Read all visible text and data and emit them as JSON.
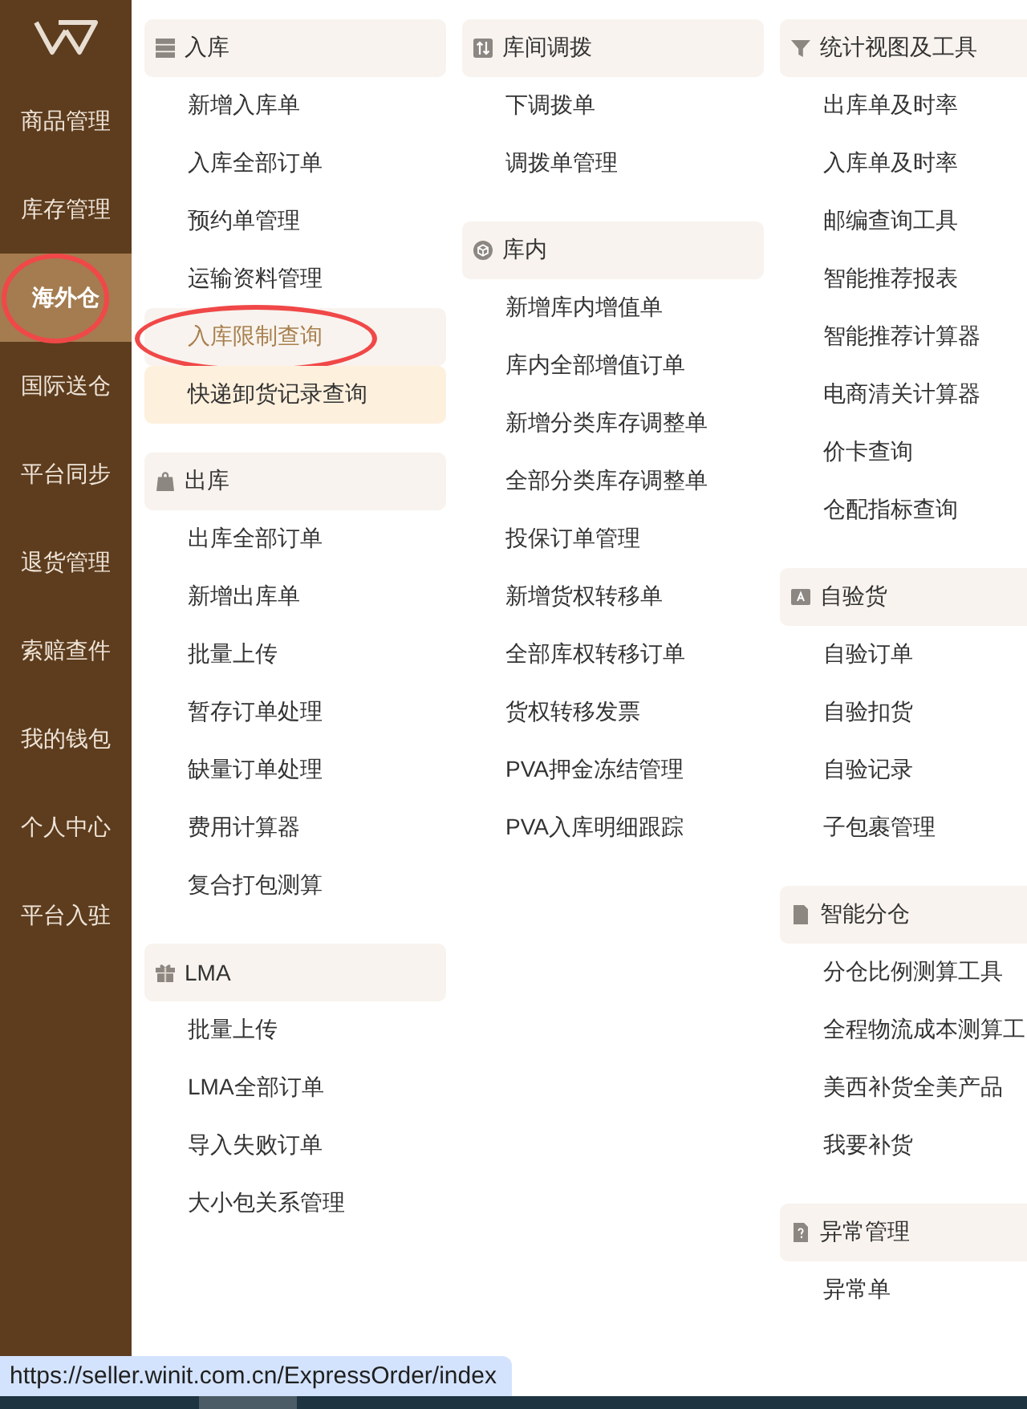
{
  "sidebar": {
    "items": [
      {
        "label": "商品管理",
        "selected": false,
        "circled": false
      },
      {
        "label": "库存管理",
        "selected": false,
        "circled": false
      },
      {
        "label": "海外仓",
        "selected": true,
        "circled": true
      },
      {
        "label": "国际送仓",
        "selected": false,
        "circled": false
      },
      {
        "label": "平台同步",
        "selected": false,
        "circled": false
      },
      {
        "label": "退货管理",
        "selected": false,
        "circled": false
      },
      {
        "label": "索赔查件",
        "selected": false,
        "circled": false
      },
      {
        "label": "我的钱包",
        "selected": false,
        "circled": false
      },
      {
        "label": "个人中心",
        "selected": false,
        "circled": false
      },
      {
        "label": "平台入驻",
        "selected": false,
        "circled": false
      }
    ]
  },
  "menu": {
    "columns": [
      {
        "groups": [
          {
            "title": "入库",
            "items": [
              {
                "label": "新增入库单",
                "selected": false,
                "hovered": false,
                "circled": false
              },
              {
                "label": "入库全部订单",
                "selected": false,
                "hovered": false,
                "circled": false
              },
              {
                "label": "预约单管理",
                "selected": false,
                "hovered": false,
                "circled": false
              },
              {
                "label": "运输资料管理",
                "selected": false,
                "hovered": false,
                "circled": false
              },
              {
                "label": "入库限制查询",
                "selected": false,
                "hovered": true,
                "circled": true
              },
              {
                "label": "快递卸货记录查询",
                "selected": true,
                "hovered": false,
                "circled": false
              }
            ]
          },
          {
            "title": "出库",
            "items": [
              {
                "label": "出库全部订单",
                "selected": false,
                "hovered": false,
                "circled": false
              },
              {
                "label": "新增出库单",
                "selected": false,
                "hovered": false,
                "circled": false
              },
              {
                "label": "批量上传",
                "selected": false,
                "hovered": false,
                "circled": false
              },
              {
                "label": "暂存订单处理",
                "selected": false,
                "hovered": false,
                "circled": false
              },
              {
                "label": "缺量订单处理",
                "selected": false,
                "hovered": false,
                "circled": false
              },
              {
                "label": "费用计算器",
                "selected": false,
                "hovered": false,
                "circled": false
              },
              {
                "label": "复合打包测算",
                "selected": false,
                "hovered": false,
                "circled": false
              }
            ]
          },
          {
            "title": "LMA",
            "items": [
              {
                "label": "批量上传",
                "selected": false,
                "hovered": false,
                "circled": false
              },
              {
                "label": "LMA全部订单",
                "selected": false,
                "hovered": false,
                "circled": false
              },
              {
                "label": "导入失败订单",
                "selected": false,
                "hovered": false,
                "circled": false
              },
              {
                "label": "大小包关系管理",
                "selected": false,
                "hovered": false,
                "circled": false
              }
            ]
          }
        ]
      },
      {
        "groups": [
          {
            "title": "库间调拨",
            "items": [
              {
                "label": "下调拨单",
                "selected": false,
                "hovered": false,
                "circled": false
              },
              {
                "label": "调拨单管理",
                "selected": false,
                "hovered": false,
                "circled": false
              }
            ]
          },
          {
            "title": "库内",
            "items": [
              {
                "label": "新增库内增值单",
                "selected": false,
                "hovered": false,
                "circled": false
              },
              {
                "label": "库内全部增值订单",
                "selected": false,
                "hovered": false,
                "circled": false
              },
              {
                "label": "新增分类库存调整单",
                "selected": false,
                "hovered": false,
                "circled": false
              },
              {
                "label": "全部分类库存调整单",
                "selected": false,
                "hovered": false,
                "circled": false
              },
              {
                "label": "投保订单管理",
                "selected": false,
                "hovered": false,
                "circled": false
              },
              {
                "label": "新增货权转移单",
                "selected": false,
                "hovered": false,
                "circled": false
              },
              {
                "label": "全部库权转移订单",
                "selected": false,
                "hovered": false,
                "circled": false
              },
              {
                "label": "货权转移发票",
                "selected": false,
                "hovered": false,
                "circled": false
              },
              {
                "label": "PVA押金冻结管理",
                "selected": false,
                "hovered": false,
                "circled": false
              },
              {
                "label": "PVA入库明细跟踪",
                "selected": false,
                "hovered": false,
                "circled": false
              }
            ]
          }
        ]
      },
      {
        "groups": [
          {
            "title": "统计视图及工具",
            "items": [
              {
                "label": "出库单及时率",
                "selected": false,
                "hovered": false,
                "circled": false
              },
              {
                "label": "入库单及时率",
                "selected": false,
                "hovered": false,
                "circled": false
              },
              {
                "label": "邮编查询工具",
                "selected": false,
                "hovered": false,
                "circled": false
              },
              {
                "label": "智能推荐报表",
                "selected": false,
                "hovered": false,
                "circled": false
              },
              {
                "label": "智能推荐计算器",
                "selected": false,
                "hovered": false,
                "circled": false
              },
              {
                "label": "电商清关计算器",
                "selected": false,
                "hovered": false,
                "circled": false
              },
              {
                "label": "价卡查询",
                "selected": false,
                "hovered": false,
                "circled": false
              },
              {
                "label": "仓配指标查询",
                "selected": false,
                "hovered": false,
                "circled": false
              }
            ]
          },
          {
            "title": "自验货",
            "items": [
              {
                "label": "自验订单",
                "selected": false,
                "hovered": false,
                "circled": false
              },
              {
                "label": "自验扣货",
                "selected": false,
                "hovered": false,
                "circled": false
              },
              {
                "label": "自验记录",
                "selected": false,
                "hovered": false,
                "circled": false
              },
              {
                "label": "子包裹管理",
                "selected": false,
                "hovered": false,
                "circled": false
              }
            ]
          },
          {
            "title": "智能分仓",
            "items": [
              {
                "label": "分仓比例测算工具",
                "selected": false,
                "hovered": false,
                "circled": false
              },
              {
                "label": "全程物流成本测算工",
                "selected": false,
                "hovered": false,
                "circled": false
              },
              {
                "label": "美西补货全美产品",
                "selected": false,
                "hovered": false,
                "circled": false
              },
              {
                "label": "我要补货",
                "selected": false,
                "hovered": false,
                "circled": false
              }
            ]
          },
          {
            "title": "异常管理",
            "items": [
              {
                "label": "异常单",
                "selected": false,
                "hovered": false,
                "circled": false
              }
            ]
          }
        ]
      }
    ]
  },
  "status_bar": {
    "url": "https://seller.winit.com.cn/ExpressOrder/index"
  }
}
